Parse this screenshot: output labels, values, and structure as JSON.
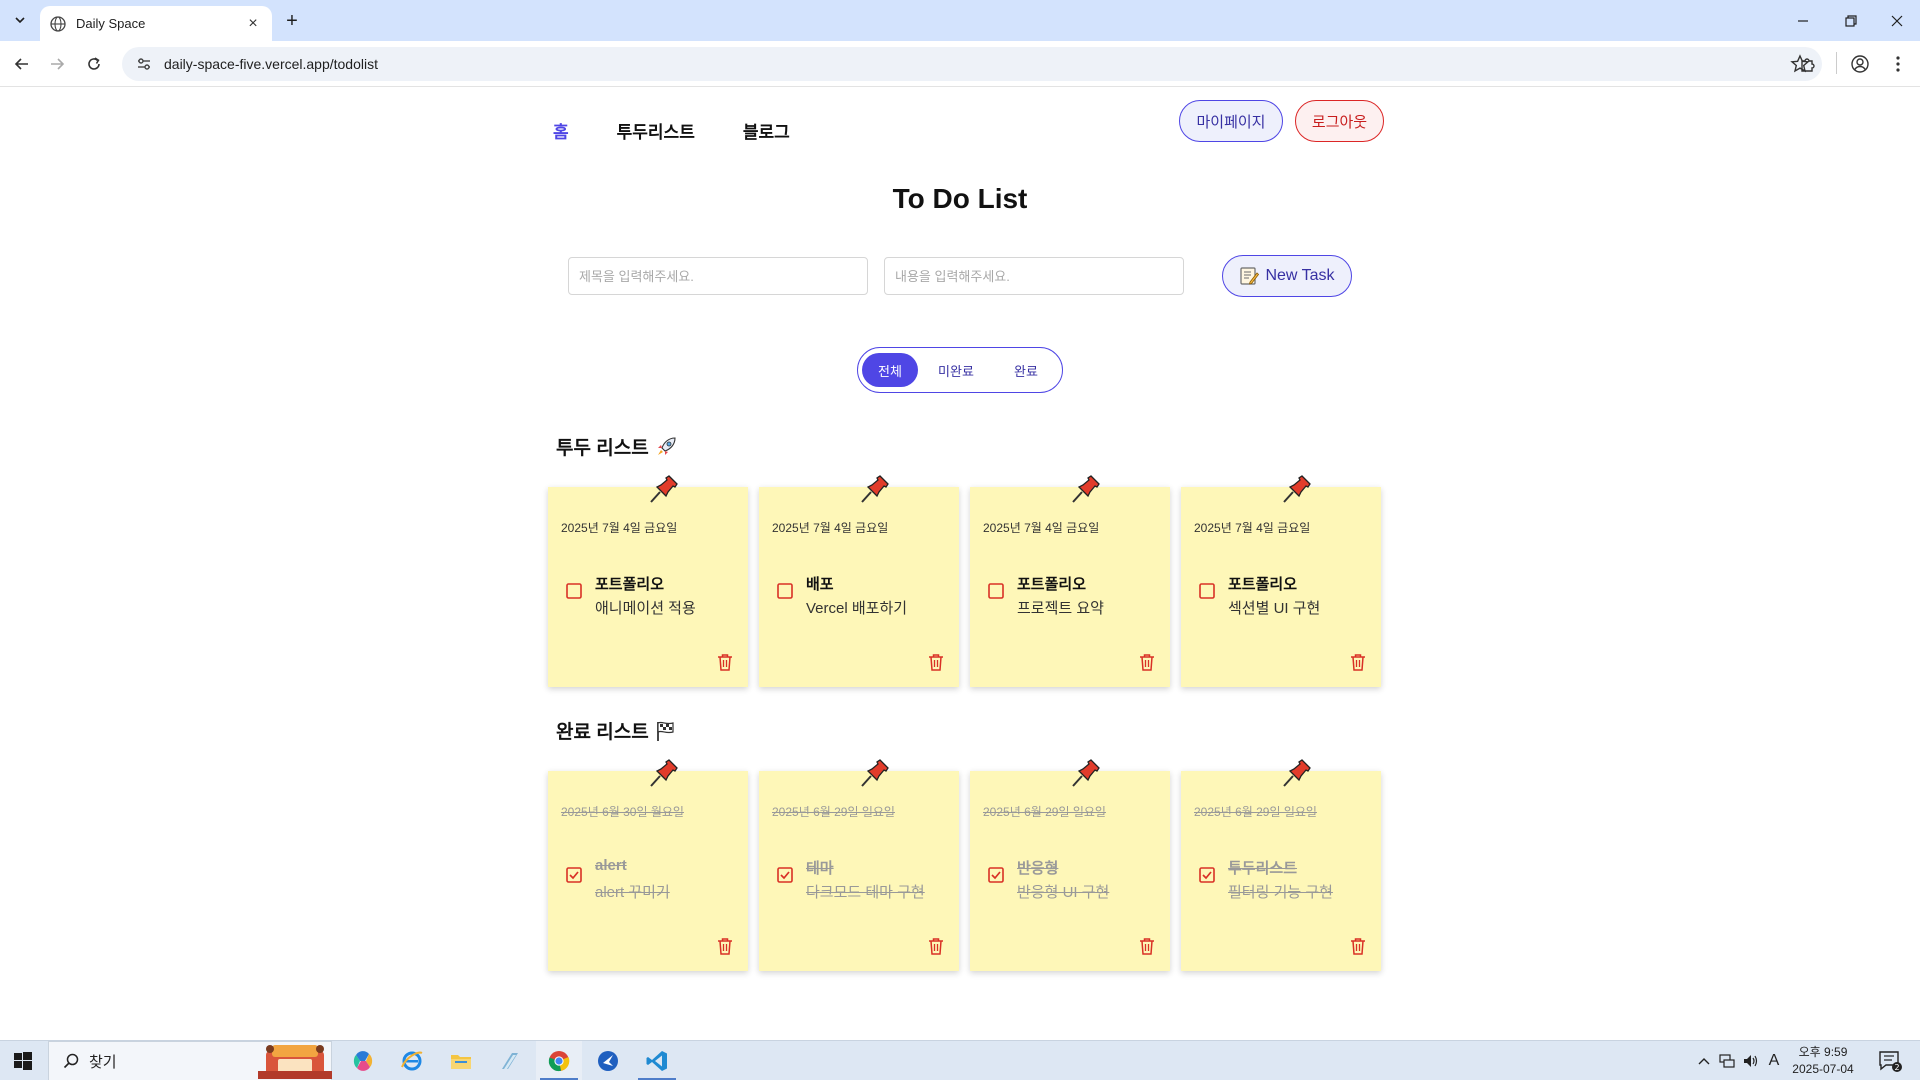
{
  "browser": {
    "tab_title": "Daily Space",
    "url": "daily-space-five.vercel.app/todolist"
  },
  "nav": {
    "home": "홈",
    "todolist": "투두리스트",
    "blog": "블로그",
    "mypage": "마이페이지",
    "logout": "로그아웃"
  },
  "page": {
    "title": "To Do List",
    "title_placeholder": "제목을 입력해주세요.",
    "content_placeholder": "내용을 입력해주세요.",
    "new_task": "New Task"
  },
  "filters": {
    "all": "전체",
    "incomplete": "미완료",
    "complete": "완료",
    "selected": "전체"
  },
  "todo_section": {
    "title": "투두 리스트",
    "icon": "rocket-icon",
    "cards": [
      {
        "date": "2025년 7월 4일 금요일",
        "title": "포트폴리오",
        "body": "애니메이션 적용",
        "done": false
      },
      {
        "date": "2025년 7월 4일 금요일",
        "title": "배포",
        "body": "Vercel 배포하기",
        "done": false
      },
      {
        "date": "2025년 7월 4일 금요일",
        "title": "포트폴리오",
        "body": "프로젝트 요약",
        "done": false
      },
      {
        "date": "2025년 7월 4일 금요일",
        "title": "포트폴리오",
        "body": "섹션별 UI 구현",
        "done": false
      }
    ]
  },
  "done_section": {
    "title": "완료 리스트",
    "icon": "flag-icon",
    "cards": [
      {
        "date": "2025년 6월 30일 월요일",
        "title": "alert",
        "body": "alert 꾸미기",
        "done": true
      },
      {
        "date": "2025년 6월 29일 일요일",
        "title": "테마",
        "body": "다크모드 테마 구현",
        "done": true
      },
      {
        "date": "2025년 6월 29일 일요일",
        "title": "반응형",
        "body": "반응형 UI 구현",
        "done": true
      },
      {
        "date": "2025년 6월 29일 일요일",
        "title": "투두리스트",
        "body": "필터링 기능 구현",
        "done": true
      }
    ]
  },
  "taskbar": {
    "search_label": "찾기",
    "time": "오후 9:59",
    "date": "2025-07-04",
    "notification_count": "2",
    "ime": "A"
  },
  "colors": {
    "accent": "#4f46e5",
    "danger": "#dc2626",
    "card_bg": "#fef7b8",
    "pin": "#e23c2b"
  }
}
